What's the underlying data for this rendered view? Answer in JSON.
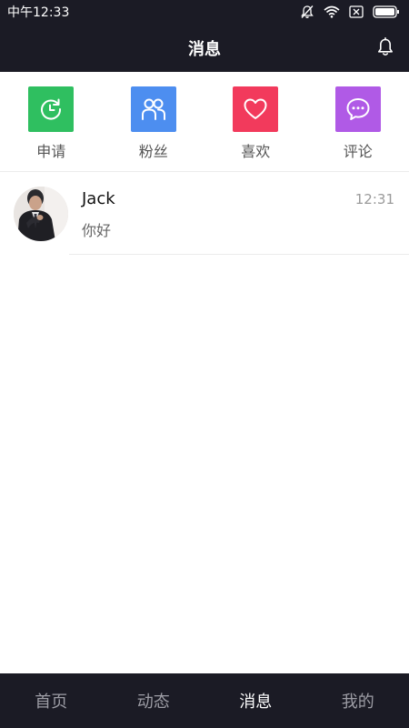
{
  "status_bar": {
    "time": "中午12:33"
  },
  "header": {
    "title": "消息"
  },
  "quick_actions": [
    {
      "label": "申请",
      "color": "#2fbf60",
      "icon": "clock-refresh-icon"
    },
    {
      "label": "粉丝",
      "color": "#4d8ef0",
      "icon": "people-icon"
    },
    {
      "label": "喜欢",
      "color": "#f23a5c",
      "icon": "heart-icon"
    },
    {
      "label": "评论",
      "color": "#b05ae6",
      "icon": "chat-bubble-icon"
    }
  ],
  "conversations": [
    {
      "name": "Jack",
      "time": "12:31",
      "preview": "你好"
    }
  ],
  "bottom_nav": {
    "items": [
      "首页",
      "动态",
      "消息",
      "我的"
    ],
    "active_index": 2
  }
}
